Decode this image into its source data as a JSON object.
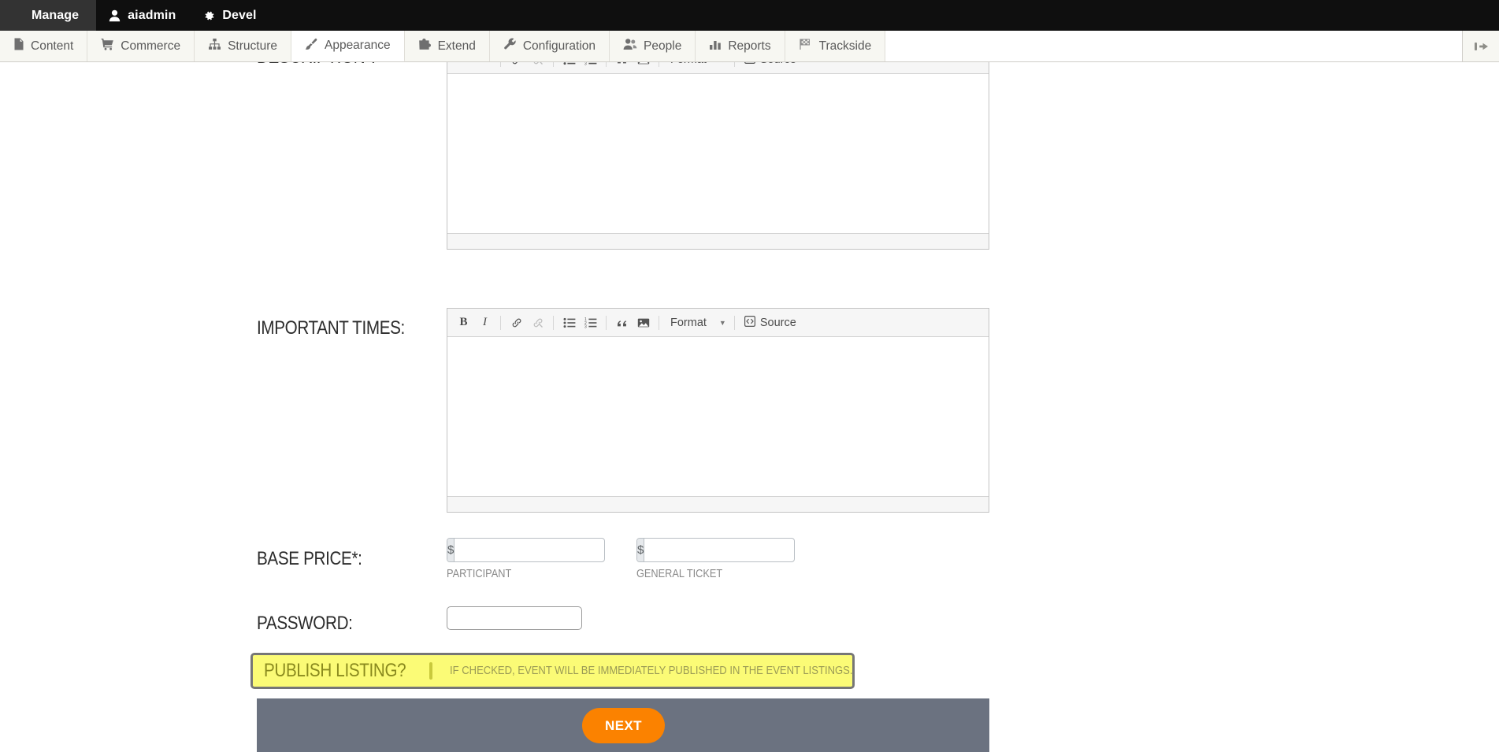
{
  "admin_toolbar": {
    "items": [
      {
        "label": "Manage",
        "icon": "hamburger-icon"
      },
      {
        "label": "aiadmin",
        "icon": "user-icon"
      },
      {
        "label": "Devel",
        "icon": "gear-icon"
      }
    ]
  },
  "menu_bar": {
    "items": [
      {
        "label": "Content",
        "icon": "document-icon"
      },
      {
        "label": "Commerce",
        "icon": "cart-icon"
      },
      {
        "label": "Structure",
        "icon": "sitemap-icon"
      },
      {
        "label": "Appearance",
        "icon": "paintbrush-icon"
      },
      {
        "label": "Extend",
        "icon": "puzzle-icon"
      },
      {
        "label": "Configuration",
        "icon": "wrench-icon"
      },
      {
        "label": "People",
        "icon": "people-icon"
      },
      {
        "label": "Reports",
        "icon": "bar-chart-icon"
      },
      {
        "label": "Trackside",
        "icon": "checkered-flag-icon"
      }
    ],
    "active_index": 3,
    "orientation_toggle_icon": "toolbar-collapse-icon"
  },
  "editor_toolbar": {
    "bold": "B",
    "italic": "I",
    "link_icon": "link-icon",
    "unlink_icon": "unlink-icon",
    "bulleted_list_icon": "bulleted-list-icon",
    "numbered_list_icon": "numbered-list-icon",
    "blockquote_icon": "blockquote-icon",
    "image_icon": "image-icon",
    "format_label": "Format",
    "source_label": "Source",
    "source_icon": "source-icon"
  },
  "form": {
    "description": {
      "label": "DESCRIPTION*:",
      "value": ""
    },
    "important_times": {
      "label": "IMPORTANT TIMES:",
      "value": ""
    },
    "base_price": {
      "label": "BASE PRICE*:",
      "currency_symbol": "$",
      "fields": [
        {
          "caption": "PARTICIPANT",
          "value": ""
        },
        {
          "caption": "GENERAL TICKET",
          "value": ""
        }
      ]
    },
    "password": {
      "label": "PASSWORD:",
      "value": "",
      "placeholder": ""
    },
    "publish_listing": {
      "label": "PUBLISH LISTING?",
      "checked": false,
      "description": "IF CHECKED, EVENT WILL BE IMMEDIATELY PUBLISHED IN THE EVENT LISTINGS."
    },
    "next_button": "NEXT"
  },
  "colors": {
    "admin_bar": "#0f0f0f",
    "menu_tab": "#f7f7f2",
    "highlight_yellow": "#fbfb76",
    "highlight_border": "#767676",
    "panel_gray": "#6b7280",
    "next_orange": "#fb8200"
  }
}
